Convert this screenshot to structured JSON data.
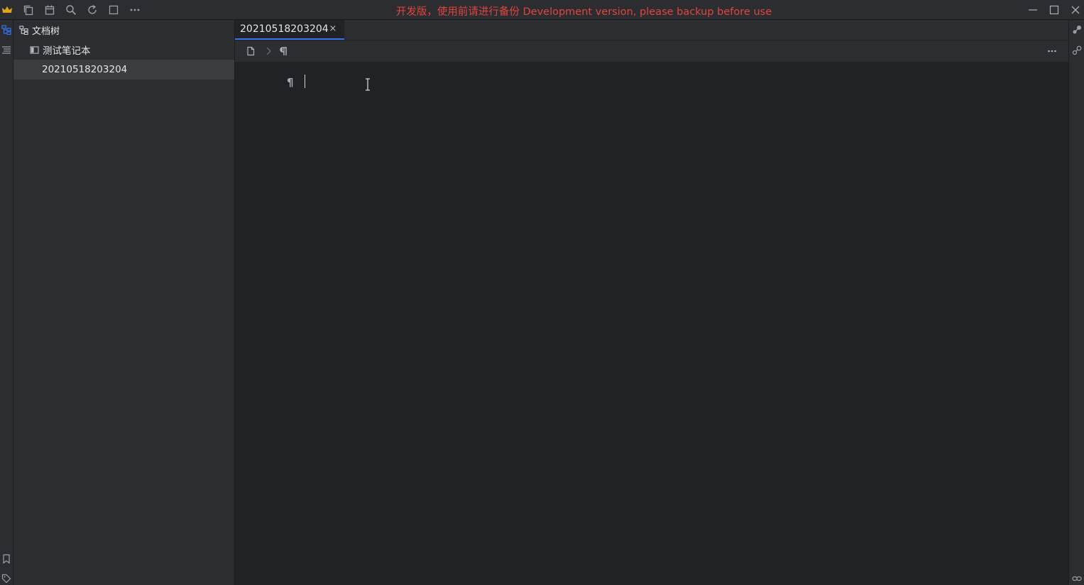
{
  "titlebar": {
    "warning": "开发版，使用前请进行备份 Development version, please backup before use",
    "icons": [
      "crown-icon",
      "copy-icon",
      "calendar-icon",
      "search-icon",
      "sync-icon",
      "square-icon",
      "more-icon"
    ]
  },
  "filetree": {
    "header_label": "文档树",
    "notebook_label": "测试笔记本",
    "doc_label": "20210518203204"
  },
  "editor": {
    "tab_label": "20210518203204",
    "tab_close": "×",
    "paragraph_mark": "¶"
  },
  "colors": {
    "accent": "#3574f0",
    "warning": "#e2453f",
    "editor_bg": "#212225",
    "panel_bg": "#2b2d30"
  }
}
